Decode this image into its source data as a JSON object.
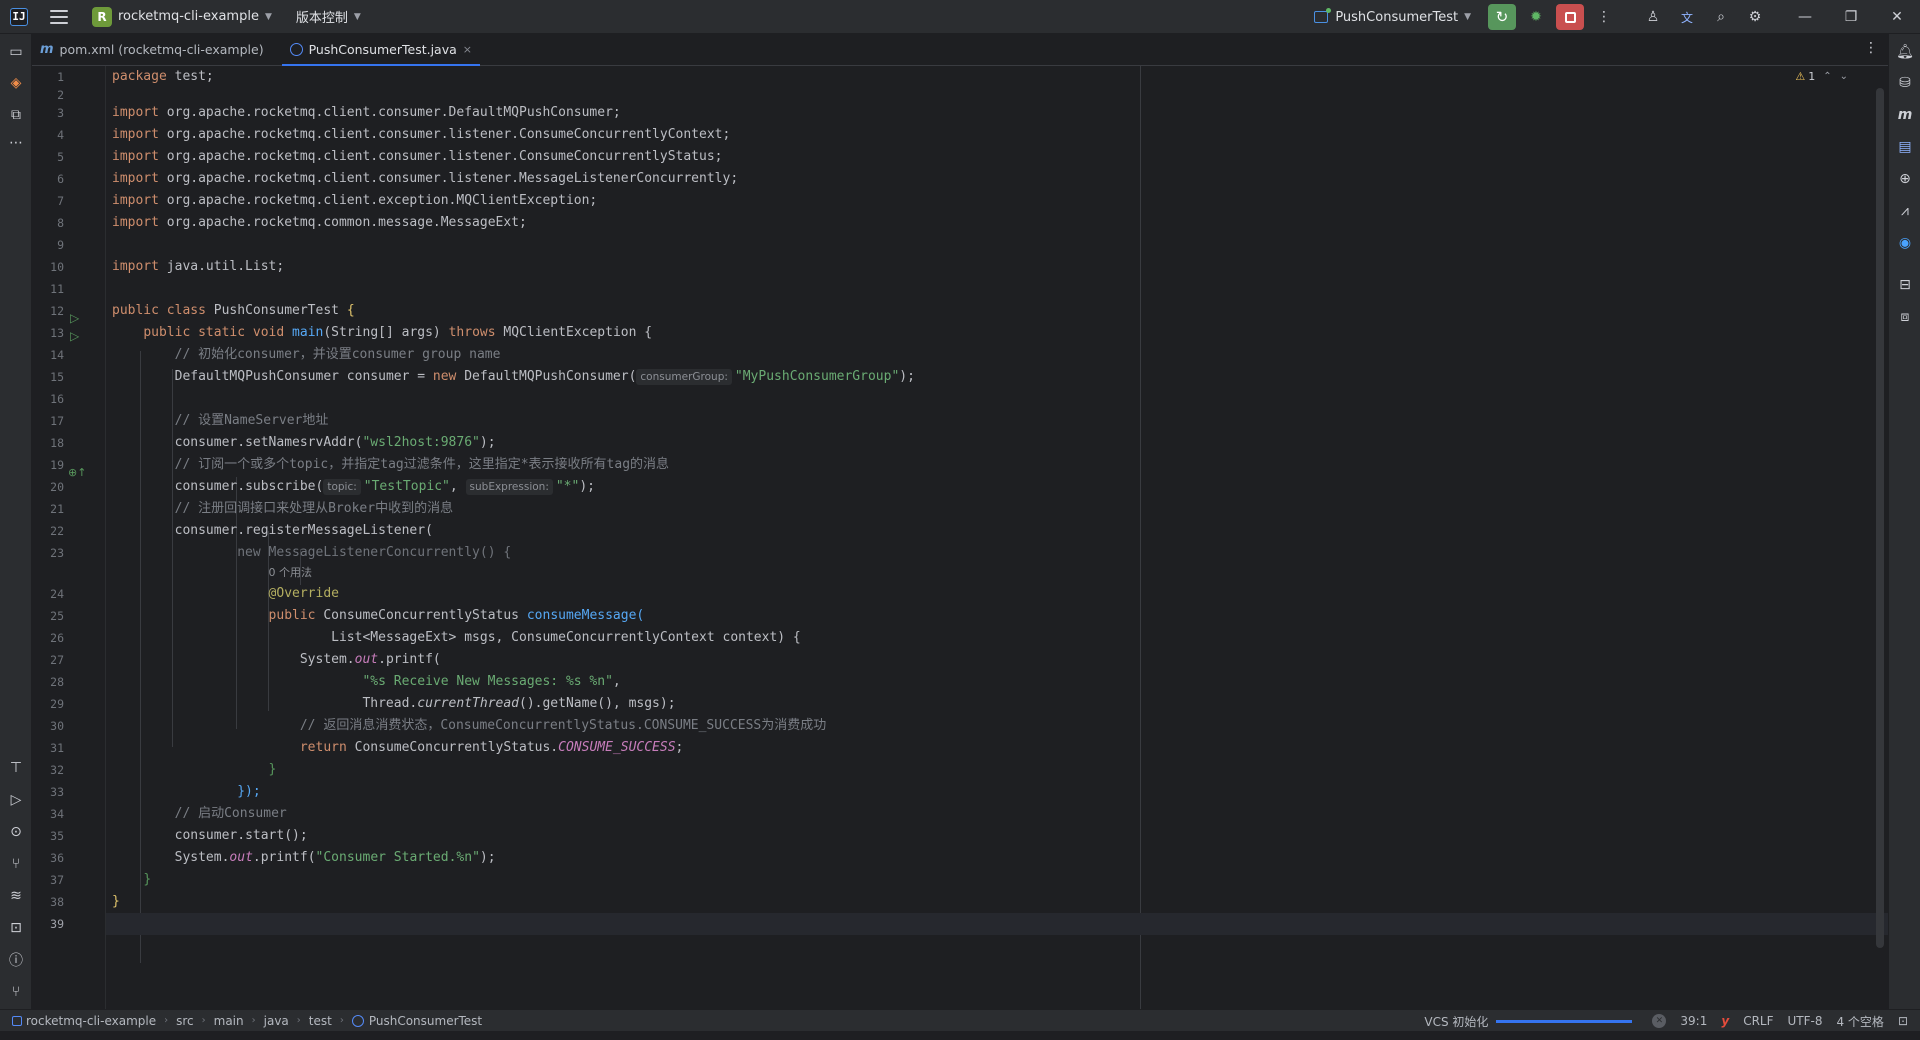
{
  "titlebar": {
    "logo": "IJ",
    "project_badge": "R",
    "project_name": "rocketmq-cli-example",
    "vcs_menu": "版本控制",
    "run_config": "PushConsumerTest"
  },
  "tabs": [
    {
      "icon": "m",
      "label": "pom.xml (rocketmq-cli-example)"
    },
    {
      "label": "PushConsumerTest.java",
      "close": "×"
    }
  ],
  "editor": {
    "warning_count": "1",
    "usage_hint": "0 个用法",
    "hints": {
      "consumer_group": "consumerGroup:",
      "topic": "topic:",
      "sub_expression": "subExpression:"
    },
    "line_numbers": [
      "1",
      "2",
      "3",
      "4",
      "5",
      "6",
      "7",
      "8",
      "9",
      "10",
      "11",
      "12",
      "13",
      "14",
      "15",
      "16",
      "17",
      "18",
      "19",
      "20",
      "21",
      "22",
      "23",
      "24",
      "25",
      "26",
      "27",
      "28",
      "29",
      "30",
      "31",
      "32",
      "33",
      "34",
      "35",
      "36",
      "37",
      "38",
      "39"
    ],
    "code": {
      "l1_kw": "package",
      "l1_rest": " test;",
      "imp": "import",
      "l3": " org.apache.rocketmq.client.consumer.DefaultMQPushConsumer;",
      "l4": " org.apache.rocketmq.client.consumer.listener.ConsumeConcurrentlyContext;",
      "l5": " org.apache.rocketmq.client.consumer.listener.ConsumeConcurrentlyStatus;",
      "l6": " org.apache.rocketmq.client.consumer.listener.MessageListenerConcurrently;",
      "l7": " org.apache.rocketmq.client.exception.MQClientException;",
      "l8": " org.apache.rocketmq.common.message.MessageExt;",
      "l10": " java.util.List;",
      "kw_public": "public",
      "kw_class": "class",
      "kw_static": "static",
      "kw_void": "void",
      "kw_throws": "throws",
      "kw_new": "new",
      "kw_return": "return",
      "class_name": "PushConsumerTest",
      "main_fn": "main",
      "main_params": "(String[] args) ",
      "mq_exc": "MQClientException",
      "c14": "// 初始化consumer，并设置consumer group name",
      "l15a": "DefaultMQPushConsumer consumer = ",
      "l15b": "DefaultMQPushConsumer(",
      "s15": "\"MyPushConsumerGroup\"",
      "c17": "// 设置NameServer地址",
      "l18": "consumer.setNamesrvAddr(",
      "s18": "\"wsl2host:9876\"",
      "c19": "// 订阅一个或多个topic，并指定tag过滤条件，这里指定*表示接收所有tag的消息",
      "l20": "consumer.subscribe(",
      "s20a": "\"TestTopic\"",
      "s20b": "\"*\"",
      "c21": "// 注册回调接口来处理从Broker中收到的消息",
      "l22": "consumer.registerMessageListener(",
      "l23": "new MessageListenerConcurrently() {",
      "l24": "@Override",
      "l25a": "ConsumeConcurrentlyStatus ",
      "l25b": "consumeMessage(",
      "l26": "List<MessageExt> msgs, ConsumeConcurrentlyContext context) {",
      "l27a": "System.",
      "l27b": "out",
      "l27c": ".printf(",
      "s28": "\"%s Receive New Messages: %s %n\"",
      "l29a": "Thread.",
      "l29b": "currentThread",
      "l29c": "().getName(), msgs);",
      "c30": "// 返回消息消费状态，ConsumeConcurrentlyStatus.CONSUME_SUCCESS为消费成功",
      "l31a": "ConsumeConcurrentlyStatus.",
      "l31b": "CONSUME_SUCCESS",
      "c34": "// 启动Consumer",
      "l35": "consumer.start();",
      "s36": "\"Consumer Started.%n\""
    }
  },
  "statusbar": {
    "breadcrumbs": [
      "rocketmq-cli-example",
      "src",
      "main",
      "java",
      "test",
      "PushConsumerTest"
    ],
    "vcs_task": "VCS 初始化",
    "progress": 0.93,
    "caret": "39:1",
    "brand_glyph": "y",
    "line_sep": "CRLF",
    "encoding": "UTF-8",
    "indent": "4 个空格"
  },
  "colors": {
    "accent": "#3574f0",
    "run_green": "#57965c",
    "stop_red": "#c94f4f",
    "keyword": "#cf8e6d",
    "string": "#6aab73",
    "comment": "#7a7e85",
    "function": "#56a8f5"
  },
  "icons": [
    "menu-icon",
    "rerun-icon",
    "debug-icon",
    "stop-icon",
    "more-icon",
    "account-icon",
    "translate-icon",
    "search-icon",
    "settings-icon",
    "minimize-icon",
    "restore-icon",
    "close-icon",
    "folder-icon",
    "commit-icon",
    "structure-icon",
    "bookmark-icon",
    "run-icon",
    "services-icon",
    "git-icon",
    "layers-icon",
    "terminal-icon",
    "problems-icon",
    "notification-icon",
    "database-icon",
    "maven-icon",
    "document-icon",
    "web-icon",
    "profiler-icon",
    "assistant-icon",
    "presentation-icon",
    "plugin-icon"
  ]
}
